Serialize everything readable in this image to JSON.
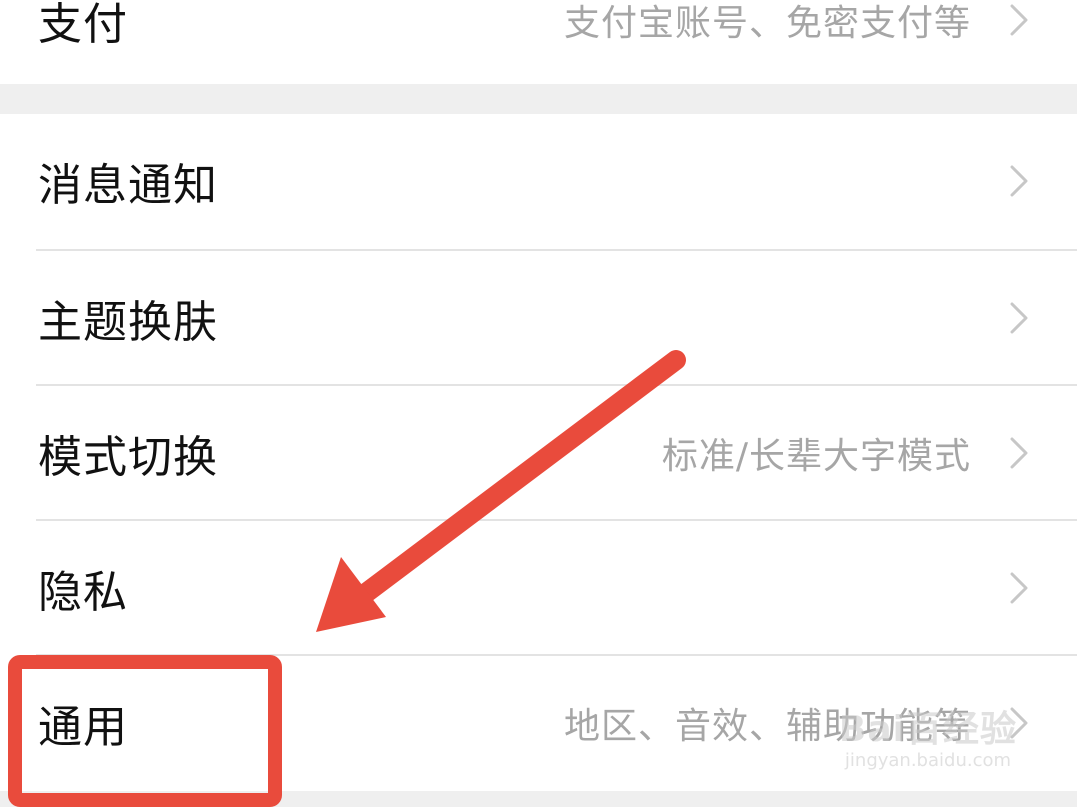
{
  "settings": {
    "items": [
      {
        "label": "支付",
        "desc": "支付宝账号、免密支付等"
      },
      {
        "label": "消息通知",
        "desc": ""
      },
      {
        "label": "主题换肤",
        "desc": ""
      },
      {
        "label": "模式切换",
        "desc": "标准/长辈大字模式"
      },
      {
        "label": "隐私",
        "desc": ""
      },
      {
        "label": "通用",
        "desc": "地区、音效、辅助功能等"
      }
    ]
  },
  "annotation": {
    "color": "#e94b3c",
    "highlight_target": "通用"
  },
  "watermark": {
    "logo": "Bai百经验",
    "url": "jingyan.baidu.com"
  },
  "colors": {
    "background": "#efefef",
    "card": "#ffffff",
    "label": "#111111",
    "desc": "#a6a6a6",
    "chevron": "#c7c7c7"
  }
}
